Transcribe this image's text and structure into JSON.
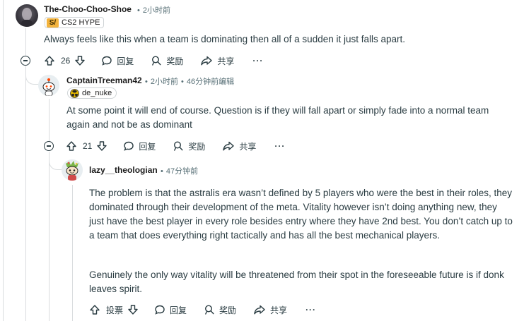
{
  "comments": [
    {
      "author": "The-Choo-Choo-Shoe",
      "time": "2小时前",
      "flair": "CS2 HYPE",
      "body": "Always feels like this when a team is dominating then all of a sudden it just falls apart.",
      "votes": "26",
      "reply": "回复",
      "award": "奖励",
      "share": "共享",
      "more": "···"
    },
    {
      "author": "CaptainTreeman42",
      "time": "2小时前",
      "edited": "46分钟前编辑",
      "flair": "de_nuke",
      "body": "At some point it will end of course. Question is if they will fall apart or simply fade into a normal team again and not be as dominant",
      "votes": "21",
      "reply": "回复",
      "award": "奖励",
      "share": "共享",
      "more": "···"
    },
    {
      "author": "lazy__theologian",
      "time": "47分钟前",
      "body_p1": "The problem is that the astralis era wasn’t defined by 5 players who were the best in their roles, they dominated through their development of the meta. Vitality however isn’t doing anything new, they just have the best player in every role besides entry where they have 2nd best. You don’t catch up to a team that does everything right tactically and has all the best mechanical players.",
      "body_p2": "Genuinely the only way vitality will be threatened from their spot in the foreseeable future is if donk leaves spirit.",
      "vote_label": "投票",
      "reply": "回复",
      "award": "奖励",
      "share": "共享",
      "more": "···"
    }
  ],
  "icons": {
    "upvote": "arrow-up-icon",
    "downvote": "arrow-down-icon",
    "reply": "speech-bubble-icon",
    "award": "award-ribbon-icon",
    "share": "share-arrow-icon",
    "collapse": "collapse-minus-icon"
  },
  "colors": {
    "text": "#2a3c42",
    "meta": "#576f76",
    "thread": "#d9dcde"
  }
}
